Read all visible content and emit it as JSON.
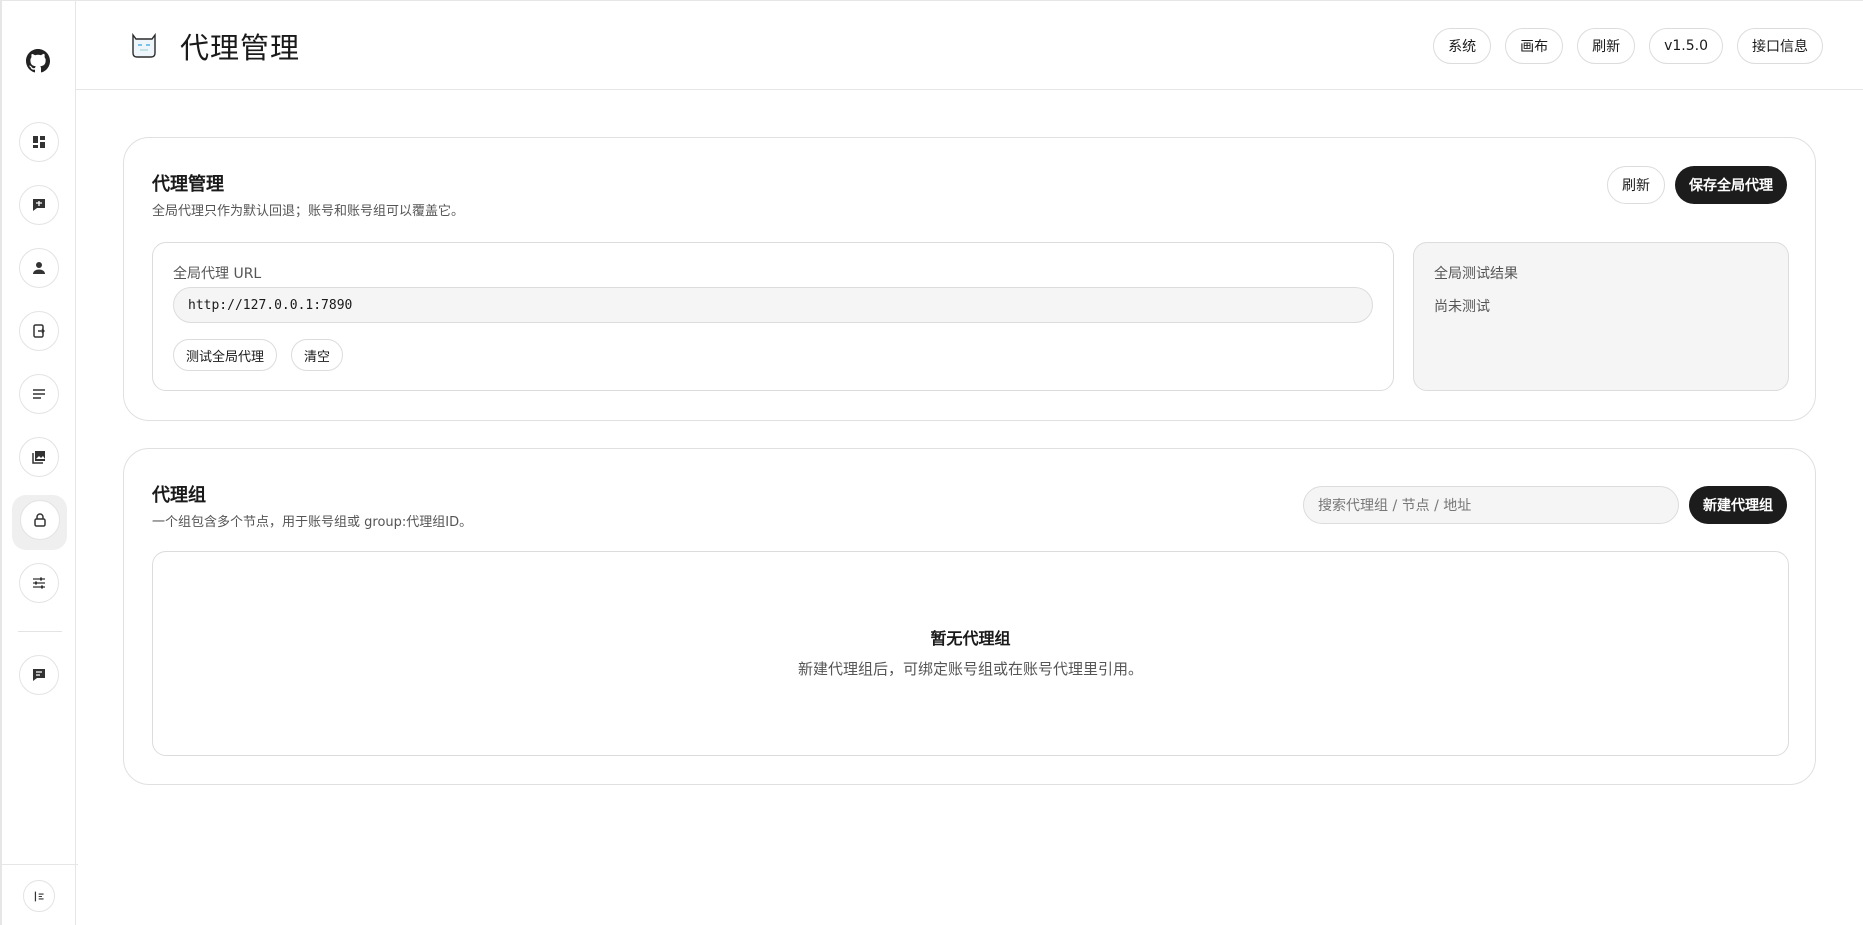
{
  "sidebar": {
    "items": [
      {
        "icon": "dashboard-icon"
      },
      {
        "icon": "chat-icon"
      },
      {
        "icon": "user-icon"
      },
      {
        "icon": "account-login-icon"
      },
      {
        "icon": "list-icon"
      },
      {
        "icon": "gallery-icon"
      },
      {
        "icon": "lock-icon",
        "active": true
      },
      {
        "icon": "sliders-icon"
      },
      {
        "icon": "message-icon"
      }
    ],
    "logo_icon": "github-icon",
    "collapse_icon": "collapse-sidebar-icon"
  },
  "header": {
    "title": "代理管理",
    "icon": "robot-cat-icon",
    "actions": [
      "系统",
      "画布",
      "刷新",
      "v1.5.0",
      "接口信息"
    ]
  },
  "proxy_card": {
    "title": "代理管理",
    "subtitle": "全局代理只作为默认回退；账号和账号组可以覆盖它。",
    "refresh_label": "刷新",
    "save_label": "保存全局代理",
    "url_label": "全局代理 URL",
    "url_value": "http://127.0.0.1:7890",
    "test_label": "测试全局代理",
    "clear_label": "清空",
    "result_label": "全局测试结果",
    "result_value": "尚未测试"
  },
  "group_card": {
    "title": "代理组",
    "subtitle": "一个组包含多个节点，用于账号组或 group:代理组ID。",
    "search_placeholder": "搜索代理组 / 节点 / 地址",
    "new_label": "新建代理组",
    "empty_title": "暂无代理组",
    "empty_desc": "新建代理组后，可绑定账号组或在账号代理里引用。"
  }
}
